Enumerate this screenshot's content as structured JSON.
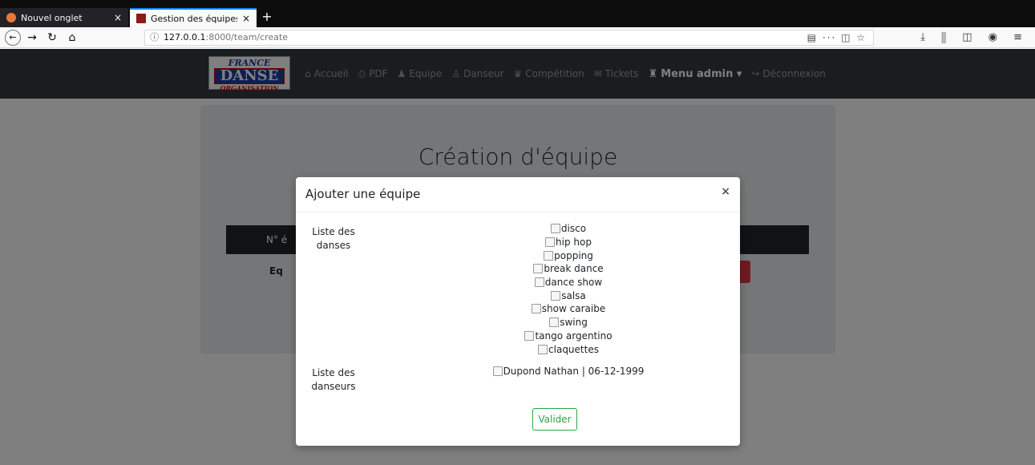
{
  "browser": {
    "tabs": [
      {
        "title": "Nouvel onglet",
        "close": "×",
        "favicon_color": "#e8793a"
      },
      {
        "title": "Gestion des équipes",
        "close": "×",
        "favicon_color": "#8b1a1a"
      }
    ],
    "new_tab": "+",
    "nav": {
      "back": "←",
      "forward": "→",
      "reload": "↻",
      "home": "⌂"
    },
    "url": {
      "info": "ⓘ",
      "host": "127.0.0.1",
      "path": ":8000/team/create"
    },
    "url_icons": "▤ ··· ◫ ☆",
    "toolbar_icons": "⤓ ⫼ ◫ ◉ ≡"
  },
  "logo": {
    "line1": "FRANCE",
    "line2": "DANSE",
    "line3": "ORGANISATION"
  },
  "menu": [
    {
      "icon": "⌂",
      "label": "Accueil"
    },
    {
      "icon": "⎙",
      "label": "PDF"
    },
    {
      "icon": "♟",
      "label": "Equipe"
    },
    {
      "icon": "♙",
      "label": "Danseur"
    },
    {
      "icon": "♛",
      "label": "Compétition"
    },
    {
      "icon": "✉",
      "label": "Tickets"
    },
    {
      "icon": "♜",
      "label": "Menu admin ▾"
    },
    {
      "icon": "↪",
      "label": "Déconnexion"
    }
  ],
  "page": {
    "title": "Création d'équipe",
    "table_header": "N° é",
    "row_label": "Eq"
  },
  "modal": {
    "title": "Ajouter une équipe",
    "close": "×",
    "dances_label": "Liste des danses",
    "dances": [
      "disco",
      "hip hop",
      "popping",
      "break dance",
      "dance show",
      "salsa",
      "show caraibe",
      "swing",
      "tango argentino",
      "claquettes"
    ],
    "dancers_label": "Liste des danseurs",
    "dancers": [
      "Dupond Nathan | 06-12-1999"
    ],
    "submit": "Valider"
  }
}
